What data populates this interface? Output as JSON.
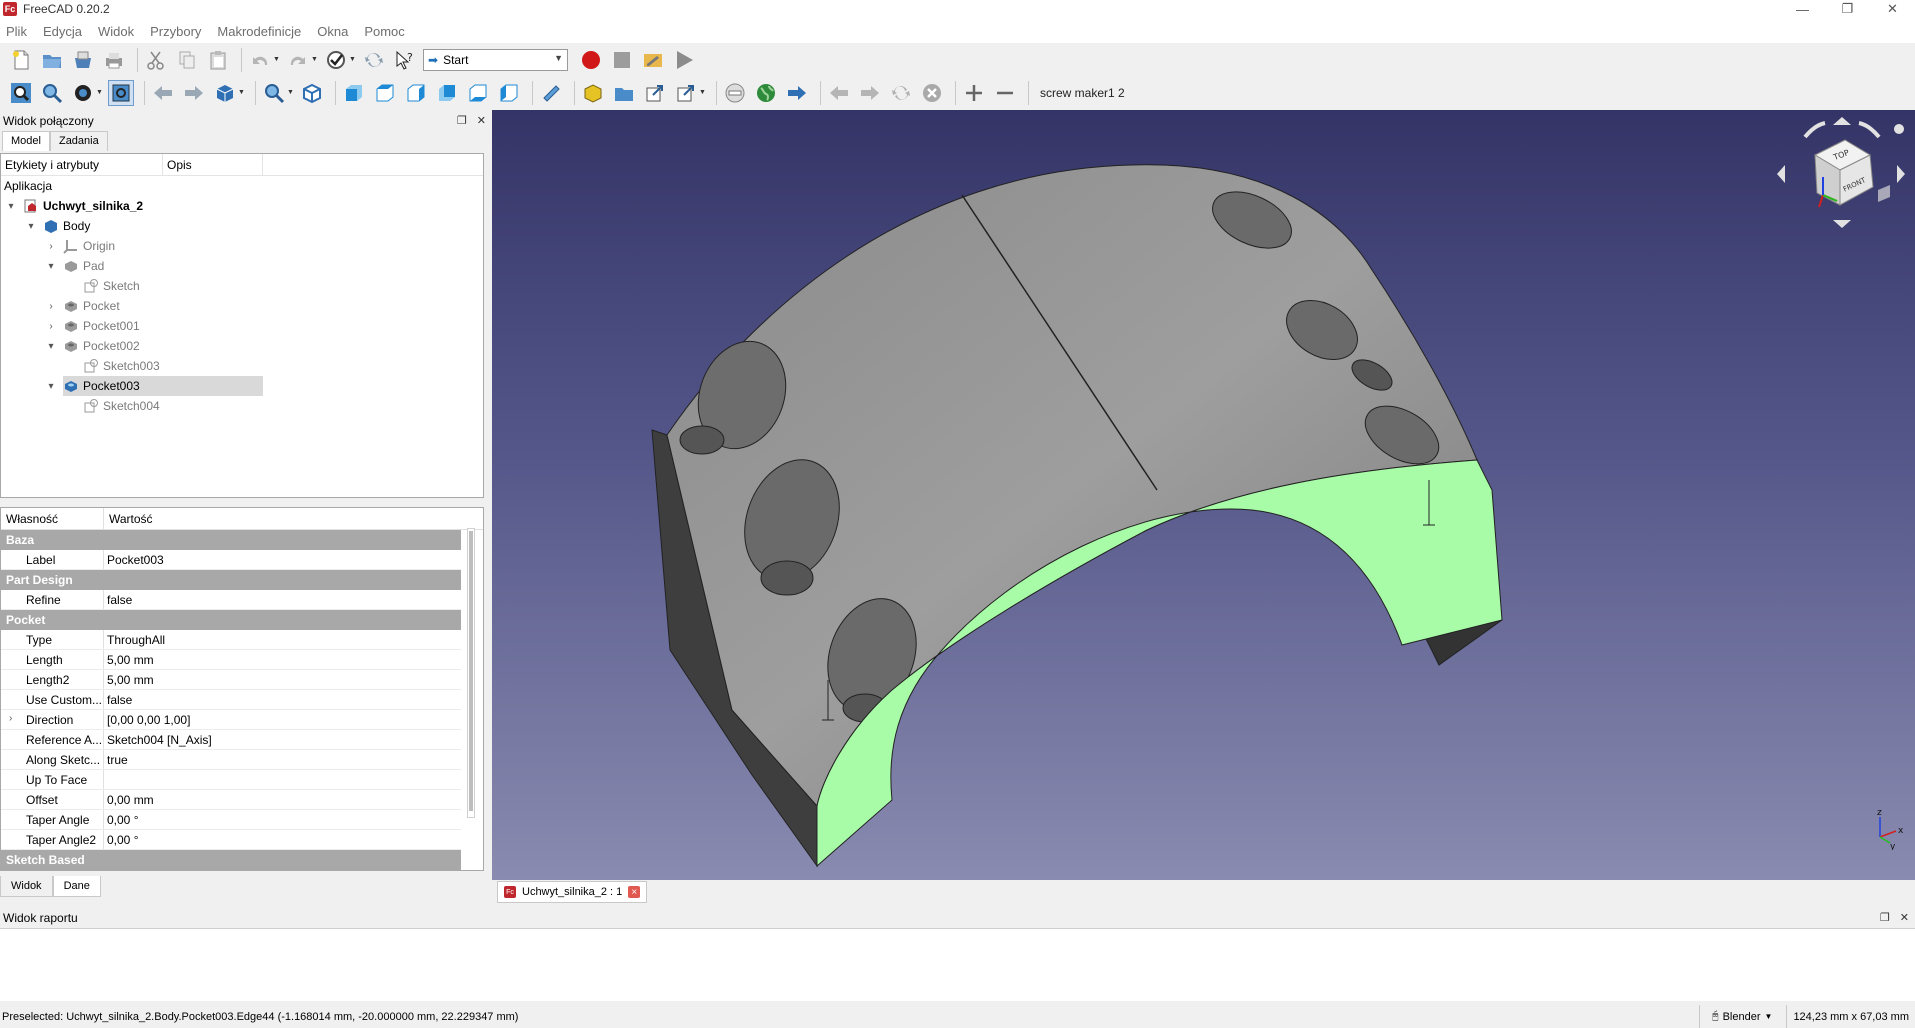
{
  "window": {
    "title": "FreeCAD 0.20.2",
    "logo": "Fc",
    "minimize": "—",
    "maximize": "❐",
    "close": "✕"
  },
  "menu": [
    "Plik",
    "Edycja",
    "Widok",
    "Przybory",
    "Makrodefinicje",
    "Okna",
    "Pomoc"
  ],
  "toolbar": {
    "workbench": "Start",
    "macro_name": "screw maker1 2"
  },
  "combo_view": {
    "title": "Widok połączony",
    "tabs": [
      "Model",
      "Zadania"
    ],
    "tree_columns": [
      "Etykiety i atrybuty",
      "Opis"
    ],
    "tree_root": "Aplikacja",
    "tree": [
      {
        "label": "Uchwyt_silnika_2",
        "level": 0,
        "expander": "▾",
        "bold": true,
        "icon": "document-icon"
      },
      {
        "label": "Body",
        "level": 1,
        "expander": "▾",
        "icon": "body-icon"
      },
      {
        "label": "Origin",
        "level": 2,
        "expander": "›",
        "grey": true,
        "icon": "origin-icon"
      },
      {
        "label": "Pad",
        "level": 2,
        "expander": "▾",
        "grey": true,
        "icon": "pad-icon"
      },
      {
        "label": "Sketch",
        "level": 3,
        "expander": "",
        "grey": true,
        "icon": "sketch-icon"
      },
      {
        "label": "Pocket",
        "level": 2,
        "expander": "›",
        "grey": true,
        "icon": "pocket-icon"
      },
      {
        "label": "Pocket001",
        "level": 2,
        "expander": "›",
        "grey": true,
        "icon": "pocket-icon"
      },
      {
        "label": "Pocket002",
        "level": 2,
        "expander": "▾",
        "grey": true,
        "icon": "pocket-icon"
      },
      {
        "label": "Sketch003",
        "level": 3,
        "expander": "",
        "grey": true,
        "icon": "sketch-icon"
      },
      {
        "label": "Pocket003",
        "level": 2,
        "expander": "▾",
        "selected": true,
        "icon": "pocket-active-icon"
      },
      {
        "label": "Sketch004",
        "level": 3,
        "expander": "",
        "grey": true,
        "icon": "sketch-icon"
      }
    ],
    "prop_columns": [
      "Własność",
      "Wartość"
    ],
    "properties": [
      {
        "group": "Baza"
      },
      {
        "name": "Label",
        "value": "Pocket003"
      },
      {
        "group": "Part Design"
      },
      {
        "name": "Refine",
        "value": "false"
      },
      {
        "group": "Pocket"
      },
      {
        "name": "Type",
        "value": "ThroughAll"
      },
      {
        "name": "Length",
        "value": "5,00 mm"
      },
      {
        "name": "Length2",
        "value": "5,00 mm"
      },
      {
        "name": "Use Custom...",
        "value": "false"
      },
      {
        "name": "Direction",
        "value": "[0,00 0,00 1,00]",
        "expander": "›"
      },
      {
        "name": "Reference A...",
        "value": "Sketch004 [N_Axis]"
      },
      {
        "name": "Along Sketc...",
        "value": "true"
      },
      {
        "name": "Up To Face",
        "value": ""
      },
      {
        "name": "Offset",
        "value": "0,00 mm"
      },
      {
        "name": "Taper Angle",
        "value": "0,00 °"
      },
      {
        "name": "Taper Angle2",
        "value": "0,00 °"
      },
      {
        "group": "Sketch Based"
      }
    ],
    "bottom_tabs": [
      "Widok",
      "Dane"
    ]
  },
  "viewer": {
    "cube_top": "TOP",
    "cube_front": "FRONT",
    "axis_x": "x",
    "axis_y": "y",
    "axis_z": "z",
    "highlight_color": "#a8fca8"
  },
  "document_tab": {
    "label": "Uchwyt_silnika_2 : 1",
    "close": "×",
    "icon": "Fc"
  },
  "report_view": {
    "title": "Widok raportu"
  },
  "status": {
    "text": "Preselected: Uchwyt_silnika_2.Body.Pocket003.Edge44 (-1.168014 mm, -20.000000 mm, 22.229347 mm)",
    "nav_style": "Blender",
    "dimensions": "124,23 mm x 67,03 mm"
  }
}
